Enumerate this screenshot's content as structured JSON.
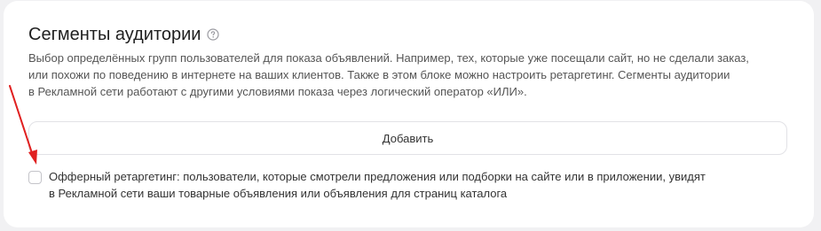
{
  "section": {
    "title": "Сегменты аудитории",
    "help_icon": "question-circle-icon",
    "description_lines": [
      "Выбор определённых групп пользователей для показа объявлений. Например, тех, которые уже посещали сайт, но не сделали заказ,",
      "или похожи по поведению в интернете на ваших клиентов. Также в этом блоке можно настроить ретаргетинг. Сегменты аудитории",
      "в Рекламной сети работают с другими условиями показа через логический оператор «ИЛИ»."
    ]
  },
  "add_button": {
    "label": "Добавить"
  },
  "offer_retargeting": {
    "checked": false,
    "label_lines": [
      "Офферный ретаргетинг: пользователи, которые смотрели предложения или подборки на сайте или в приложении, увидят",
      "в Рекламной сети ваши товарные объявления или объявления для страниц каталога"
    ]
  },
  "annotation": {
    "arrow_color": "#e02020"
  }
}
